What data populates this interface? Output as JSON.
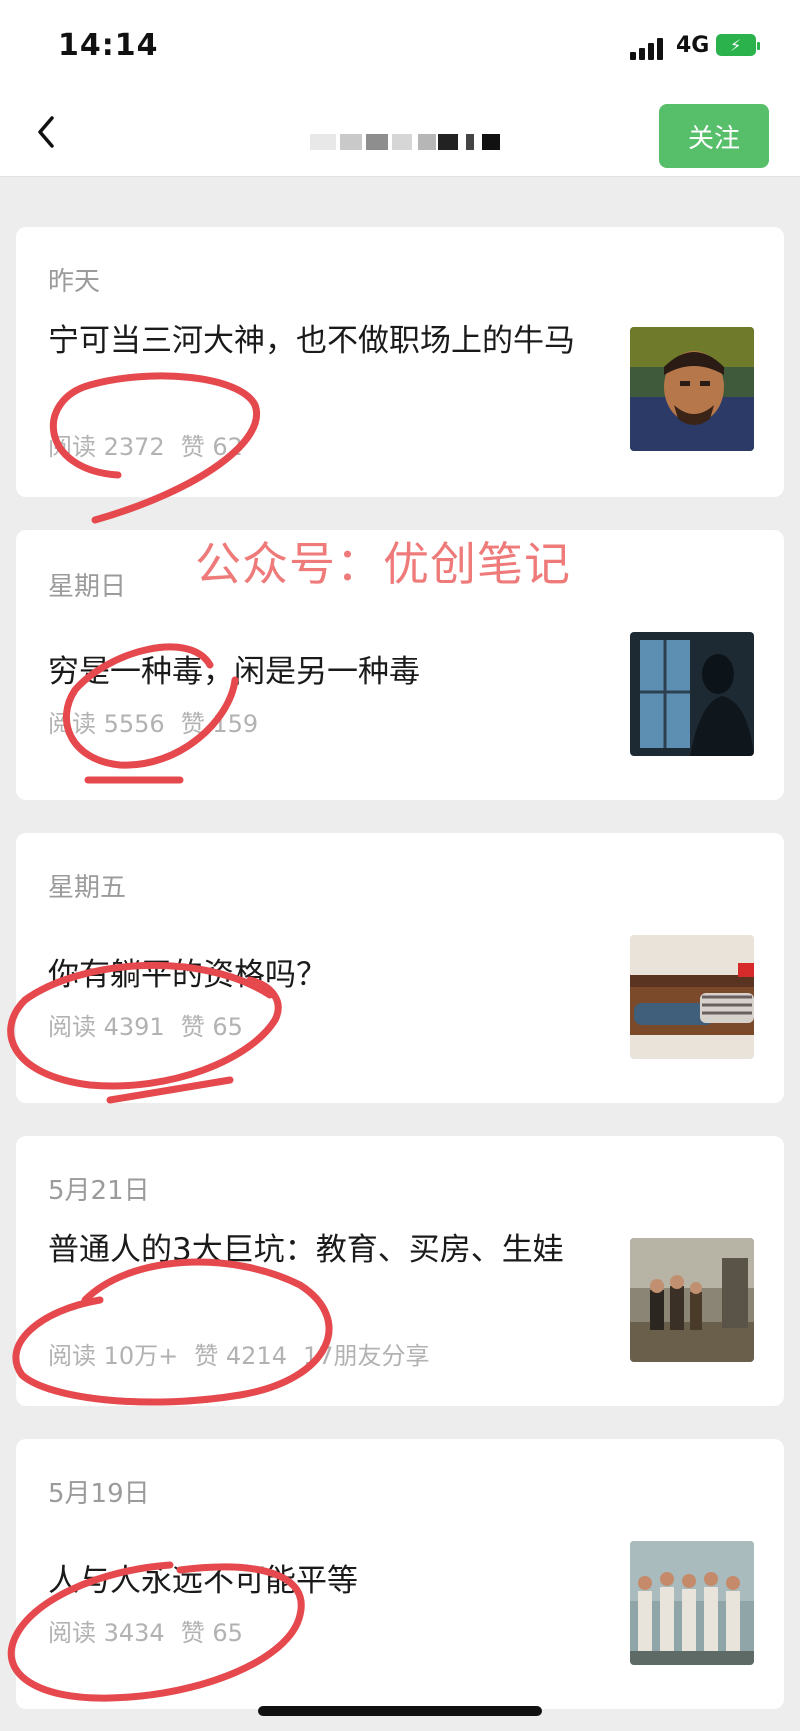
{
  "status": {
    "time": "14:14",
    "network": "4G"
  },
  "header": {
    "follow_label": "关注"
  },
  "watermark": "公众号：优创笔记",
  "articles": [
    {
      "date": "昨天",
      "title": "宁可当三河大神，也不做职场上的牛马",
      "read": "阅读 2372",
      "likes": "赞 62",
      "shares": ""
    },
    {
      "date": "星期日",
      "title": "穷是一种毒，闲是另一种毒",
      "read": "阅读 5556",
      "likes": "赞 159",
      "shares": ""
    },
    {
      "date": "星期五",
      "title": "你有躺平的资格吗？",
      "read": "阅读 4391",
      "likes": "赞 65",
      "shares": ""
    },
    {
      "date": "5月21日",
      "title": "普通人的3大巨坑：教育、买房、生娃",
      "read": "阅读 10万+",
      "likes": "赞 4214",
      "shares": "17朋友分享"
    },
    {
      "date": "5月19日",
      "title": "人与人永远不可能平等",
      "read": "阅读 3434",
      "likes": "赞 65",
      "shares": ""
    }
  ],
  "colors": {
    "accent": "#57be6a",
    "annotation": "#e5484d"
  }
}
